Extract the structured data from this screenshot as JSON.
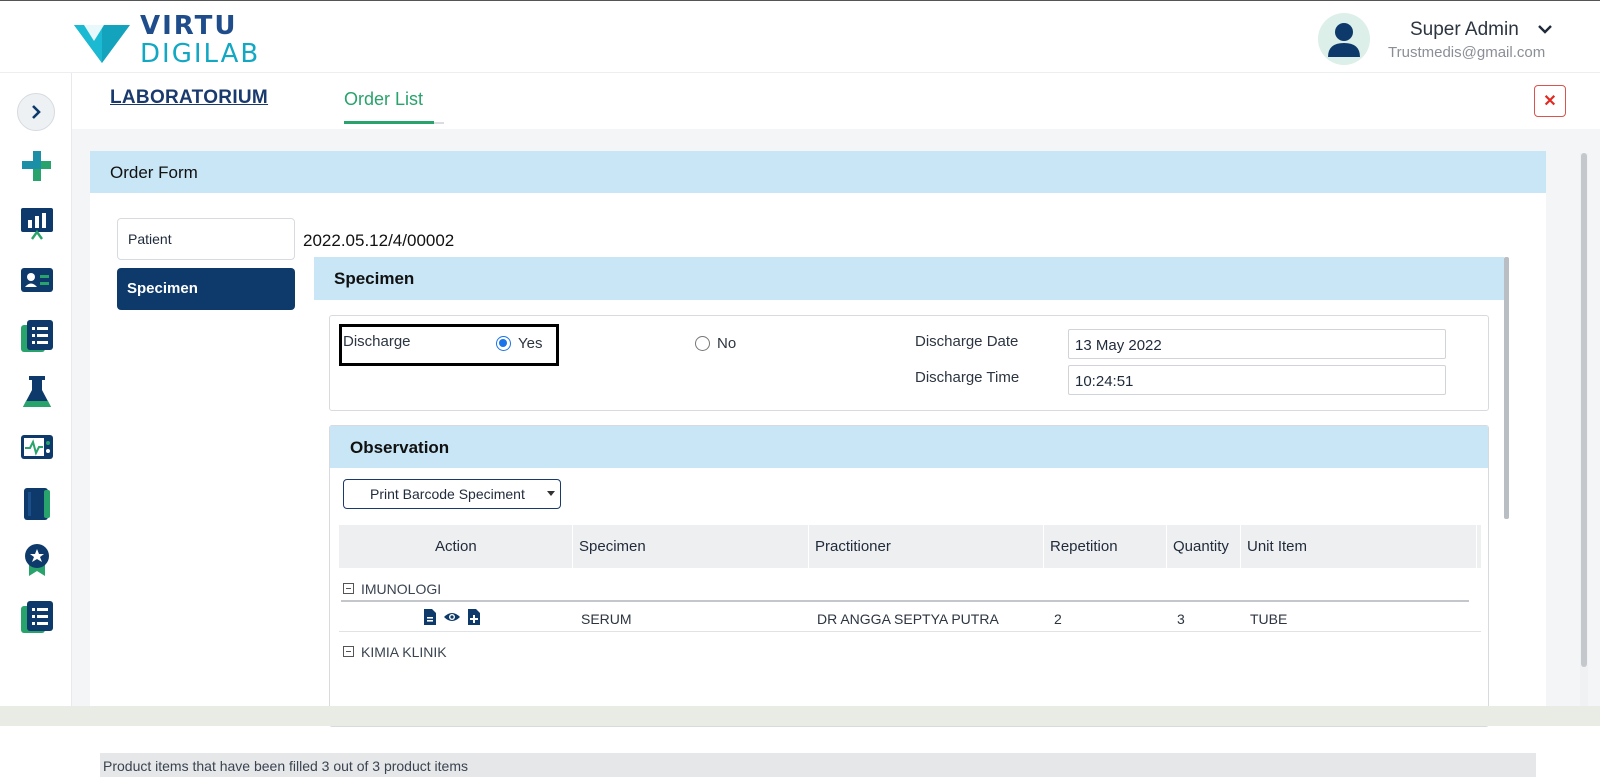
{
  "app": {
    "brand_line1": "VIRTU",
    "brand_line2": "DIGILAB"
  },
  "user": {
    "name": "Super Admin",
    "email": "Trustmedis@gmail.com"
  },
  "sidebar": {
    "icons": [
      "chevron-right-icon",
      "medical-cross-icon",
      "chart-board-icon",
      "id-card-icon",
      "document-list-icon",
      "flask-icon",
      "monitor-pulse-icon",
      "book-icon",
      "award-ribbon-icon",
      "document-list-icon"
    ]
  },
  "tabs": {
    "laboratorium": "LABORATORIUM",
    "order_list": "Order List",
    "close": "✕"
  },
  "order_form": {
    "title": "Order Form",
    "nav": {
      "patient": "Patient",
      "specimen": "Specimen"
    },
    "order_number": "2022.05.12/4/00002"
  },
  "specimen": {
    "title": "Specimen",
    "discharge_label": "Discharge",
    "yes_label": "Yes",
    "no_label": "No",
    "selected": "Yes",
    "discharge_date_label": "Discharge Date",
    "discharge_date_value": "13 May 2022",
    "discharge_time_label": "Discharge Time",
    "discharge_time_value": "10:24:51"
  },
  "observation": {
    "title": "Observation",
    "print_button": "Print Barcode Speciment",
    "columns": [
      "Action",
      "Specimen",
      "Practitioner",
      "Repetition",
      "Quantity",
      "Unit Item"
    ],
    "groups": [
      {
        "name": "IMUNOLOGI",
        "rows": [
          {
            "specimen": "SERUM",
            "practitioner": "DR ANGGA SEPTYA PUTRA",
            "repetition": "2",
            "quantity": "3",
            "unit_item": "TUBE"
          }
        ]
      },
      {
        "name": "KIMIA KLINIK"
      }
    ]
  },
  "footer": {
    "message": "Product items that have been filled 3 out of 3 product items"
  },
  "colors": {
    "primary": "#0d3a6b",
    "accent": "#27a36b",
    "header_bg": "#c8e6f5",
    "close": "#e02a22"
  }
}
